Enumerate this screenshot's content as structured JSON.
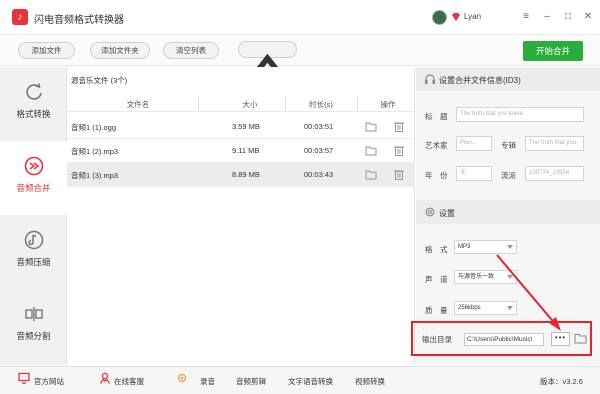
{
  "app": {
    "title": "闪电音频格式转换器",
    "username": "Lyan",
    "logo_glyph": "♪"
  },
  "window_controls": {
    "menu": "≡",
    "minimize": "–",
    "maximize": "□",
    "close": "✕"
  },
  "toolbar": {
    "add_file": "添加文件",
    "add_folder": "添加文件夹",
    "clear_list": "清空列表",
    "start_merge": "开始合并"
  },
  "sidebar": {
    "items": [
      {
        "label": "格式转换",
        "icon": "refresh-icon",
        "active": false
      },
      {
        "label": "音频合并",
        "icon": "merge-icon",
        "active": true
      },
      {
        "label": "音频压缩",
        "icon": "compress-icon",
        "active": false
      },
      {
        "label": "音频分割",
        "icon": "split-icon",
        "active": false
      }
    ]
  },
  "filelist": {
    "title": "源音乐文件 (3个)",
    "columns": [
      "文件名",
      "大小",
      "时长(s)",
      "操作"
    ],
    "rows": [
      {
        "name": "音频1 (1).ogg",
        "size": "3.59 MB",
        "duration": "00:03:51",
        "selected": false
      },
      {
        "name": "音频1 (2).mp3",
        "size": "9.11 MB",
        "duration": "00:03:57",
        "selected": false
      },
      {
        "name": "音频1 (3).mp3",
        "size": "8.89 MB",
        "duration": "00:03:43",
        "selected": true
      }
    ]
  },
  "id3": {
    "section_title": "设置合并文件信息(ID3)",
    "title_label": "标　题",
    "title_placeholder": "The truth that you leave",
    "artist_label": "艺术家",
    "artist_placeholder": "Pian...",
    "album_label": "专辑",
    "album_placeholder": "The truth that you",
    "year_label": "年　份",
    "year_placeholder": "无",
    "genre_label": "流派",
    "genre_placeholder": "139774_13934"
  },
  "settings": {
    "section_title": "设置",
    "format_label": "格　式",
    "format_value": "MP3",
    "channel_label": "声　道",
    "channel_value": "与源音乐一致",
    "quality_label": "质　量",
    "quality_value": "256kbps",
    "output_label": "输出目录",
    "output_path": "C:\\Users\\Public\\Music\\",
    "browse_label": "•••"
  },
  "footer": {
    "links": [
      "官方网站",
      "在线客服",
      "录音",
      "音频剪辑",
      "文字语音转换",
      "视频转换"
    ],
    "version": "版本：v3.2.6"
  },
  "colors": {
    "accent_red": "#e6343a",
    "start_green": "#2aad3c",
    "highlight_box": "#e8232b"
  }
}
